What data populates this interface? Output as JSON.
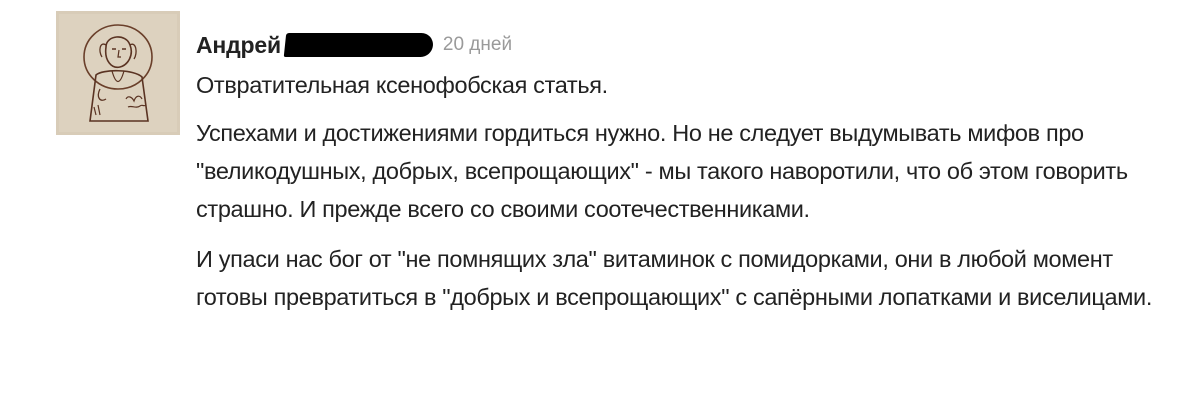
{
  "comment": {
    "author": "Андрей",
    "time": "20 дней",
    "paragraphs": [
      "Отвратительная ксенофобская статья.",
      "Успехами и достижениями гордиться нужно. Но не следует выдумывать мифов про \"великодушных, добрых, всепрощающих\" - мы такого наворотили, что об этом говорить страшно. И прежде всего со своими соотечественниками.",
      "И упаси нас бог от \"не помнящих зла\" витаминок с помидорками, они в любой момент готовы превратиться в \"добрых и всепрощающих\" с сапёрными лопатками и виселицами."
    ]
  },
  "colors": {
    "text": "#222222",
    "time": "#9a9a9a",
    "avatar_background": "#d8ccb8",
    "redaction": "#000000"
  },
  "icons": {
    "avatar": "hand-drawn-portrait-sketch-avatar"
  }
}
